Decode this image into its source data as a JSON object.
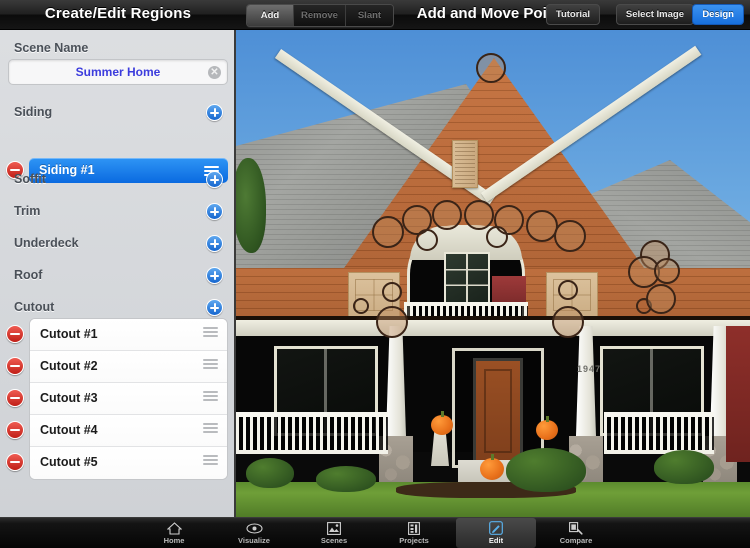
{
  "panel": {
    "title": "Create/Edit Regions",
    "scene_name_label": "Scene Name",
    "scene_name_value": "Summer Home",
    "clear_icon": "clear-circle-icon",
    "sections": [
      {
        "label": "Siding",
        "add_icon": "plus-circle-icon"
      },
      {
        "label": "Soffit",
        "add_icon": "plus-circle-icon"
      },
      {
        "label": "Trim",
        "add_icon": "plus-circle-icon"
      },
      {
        "label": "Underdeck",
        "add_icon": "plus-circle-icon"
      },
      {
        "label": "Roof",
        "add_icon": "plus-circle-icon"
      },
      {
        "label": "Cutout",
        "add_icon": "plus-circle-icon"
      }
    ],
    "siding_regions": [
      {
        "label": "Siding #1",
        "selected": true,
        "delete_icon": "minus-circle-icon",
        "reorder_icon": "reorder-grip-icon"
      }
    ],
    "cutout_regions": [
      {
        "label": "Cutout #1",
        "delete_icon": "minus-circle-icon",
        "reorder_icon": "reorder-grip-icon"
      },
      {
        "label": "Cutout #2",
        "delete_icon": "minus-circle-icon",
        "reorder_icon": "reorder-grip-icon"
      },
      {
        "label": "Cutout #3",
        "delete_icon": "minus-circle-icon",
        "reorder_icon": "reorder-grip-icon"
      },
      {
        "label": "Cutout #4",
        "delete_icon": "minus-circle-icon",
        "reorder_icon": "reorder-grip-icon"
      },
      {
        "label": "Cutout #5",
        "delete_icon": "minus-circle-icon",
        "reorder_icon": "reorder-grip-icon"
      }
    ]
  },
  "toolbar": {
    "title": "Add and Move Points",
    "segments": [
      {
        "label": "Add",
        "selected": true
      },
      {
        "label": "Remove",
        "selected": false
      },
      {
        "label": "Slant",
        "selected": false
      }
    ],
    "tutorial_label": "Tutorial",
    "select_image_label": "Select Image",
    "design_label": "Design",
    "accent_color": "#2a7de8"
  },
  "tabbar": {
    "items": [
      {
        "label": "Home",
        "icon": "home-icon",
        "active": false
      },
      {
        "label": "Visualize",
        "icon": "eye-icon",
        "active": false
      },
      {
        "label": "Scenes",
        "icon": "photo-icon",
        "active": false
      },
      {
        "label": "Projects",
        "icon": "document-icon",
        "active": false
      },
      {
        "label": "Edit",
        "icon": "pencil-icon",
        "active": true
      },
      {
        "label": "Compare",
        "icon": "compare-icon",
        "active": false
      }
    ]
  },
  "canvas": {
    "house_number": "1947",
    "marker_count": 20,
    "marker_color": "#3a2417"
  }
}
